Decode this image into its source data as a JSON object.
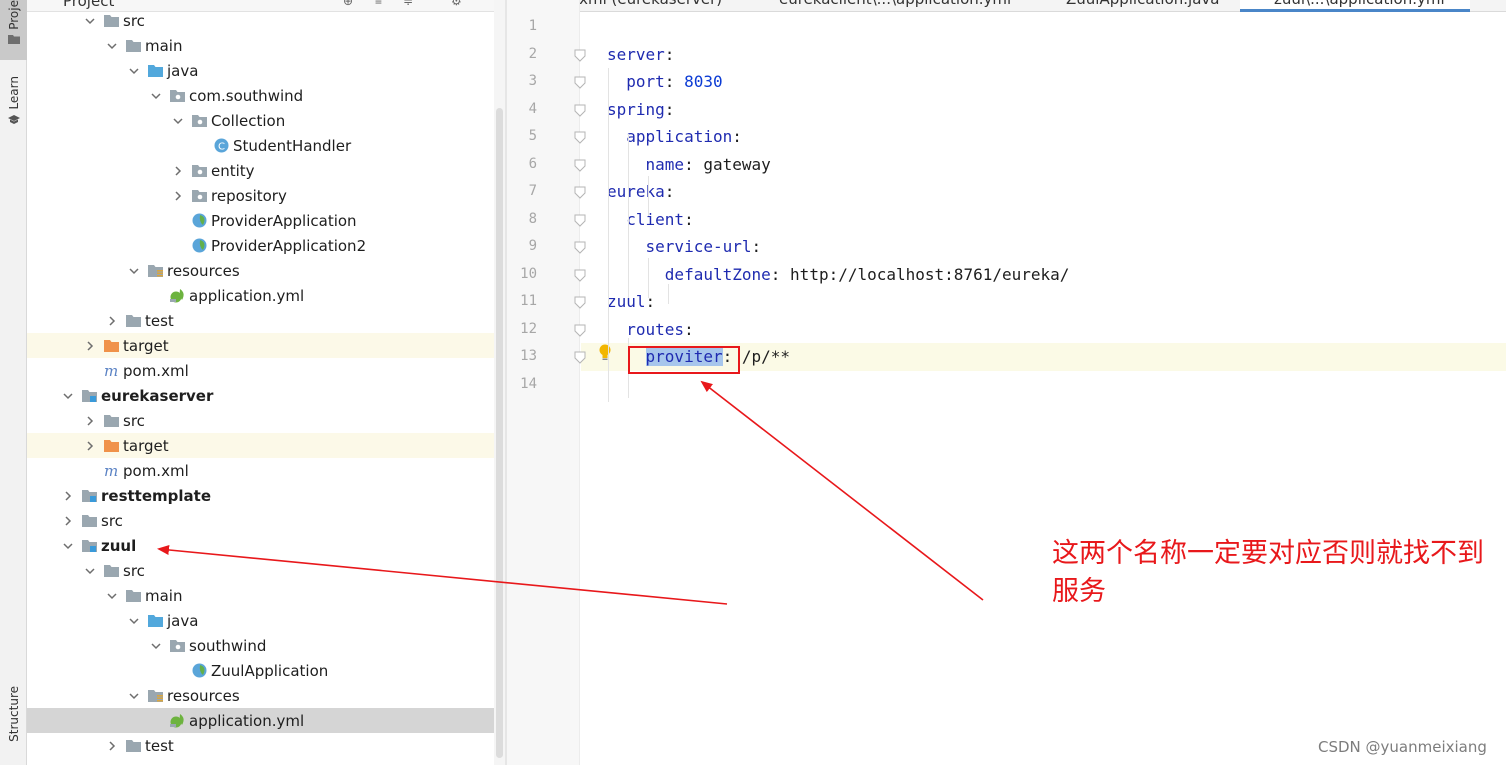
{
  "tool_strip": {
    "top_tab": "Proje",
    "learn_tab": "Learn",
    "structure_tab": "Structure"
  },
  "project_panel": {
    "title": "Project"
  },
  "tree": [
    {
      "label": "src",
      "icon": "folder-icon",
      "depth": 3,
      "expanded": true
    },
    {
      "label": "main",
      "icon": "folder-icon",
      "depth": 4,
      "expanded": true
    },
    {
      "label": "java",
      "icon": "source-folder-icon",
      "depth": 5,
      "expanded": true
    },
    {
      "label": "com.southwind",
      "icon": "package-icon",
      "depth": 6,
      "expanded": true
    },
    {
      "label": "Collection",
      "icon": "package-icon",
      "depth": 7,
      "expanded": true
    },
    {
      "label": "StudentHandler",
      "icon": "class-icon",
      "depth": 8,
      "expanded": null
    },
    {
      "label": "entity",
      "icon": "package-icon",
      "depth": 7,
      "expanded": false
    },
    {
      "label": "repository",
      "icon": "package-icon",
      "depth": 7,
      "expanded": false
    },
    {
      "label": "ProviderApplication",
      "icon": "spring-class-icon",
      "depth": 7,
      "expanded": null
    },
    {
      "label": "ProviderApplication2",
      "icon": "spring-class-icon",
      "depth": 7,
      "expanded": null
    },
    {
      "label": "resources",
      "icon": "resources-folder-icon",
      "depth": 5,
      "expanded": true
    },
    {
      "label": "application.yml",
      "icon": "spring-yml-icon",
      "depth": 6,
      "expanded": null
    },
    {
      "label": "test",
      "icon": "folder-icon",
      "depth": 4,
      "expanded": false
    },
    {
      "label": "target",
      "icon": "excluded-folder-icon",
      "depth": 3,
      "expanded": false,
      "highlight": true
    },
    {
      "label": "pom.xml",
      "icon": "maven-icon",
      "depth": 3,
      "expanded": null
    },
    {
      "label": "eurekaserver",
      "icon": "module-icon",
      "depth": 2,
      "expanded": true,
      "bold": true
    },
    {
      "label": "src",
      "icon": "folder-icon",
      "depth": 3,
      "expanded": false
    },
    {
      "label": "target",
      "icon": "excluded-folder-icon",
      "depth": 3,
      "expanded": false,
      "highlight": true
    },
    {
      "label": "pom.xml",
      "icon": "maven-icon",
      "depth": 3,
      "expanded": null
    },
    {
      "label": "resttemplate",
      "icon": "module-icon",
      "depth": 2,
      "expanded": false,
      "bold": true
    },
    {
      "label": "src",
      "icon": "folder-icon",
      "depth": 2,
      "expanded": false
    },
    {
      "label": "zuul",
      "icon": "module-icon",
      "depth": 2,
      "expanded": true,
      "bold": true
    },
    {
      "label": "src",
      "icon": "folder-icon",
      "depth": 3,
      "expanded": true
    },
    {
      "label": "main",
      "icon": "folder-icon",
      "depth": 4,
      "expanded": true
    },
    {
      "label": "java",
      "icon": "source-folder-icon",
      "depth": 5,
      "expanded": true
    },
    {
      "label": "southwind",
      "icon": "package-icon",
      "depth": 6,
      "expanded": true
    },
    {
      "label": "ZuulApplication",
      "icon": "spring-class-icon",
      "depth": 7,
      "expanded": null
    },
    {
      "label": "resources",
      "icon": "resources-folder-icon",
      "depth": 5,
      "expanded": true
    },
    {
      "label": "application.yml",
      "icon": "spring-yml-icon",
      "depth": 6,
      "expanded": null,
      "selected": true
    },
    {
      "label": "test",
      "icon": "folder-icon",
      "depth": 4,
      "expanded": false
    }
  ],
  "editor": {
    "tabs": [
      {
        "label": "pom.xml (eurekaserver)",
        "active": false
      },
      {
        "label": "eurekaclient\\...\\application.yml",
        "active": false
      },
      {
        "label": "ZuulApplication.java",
        "active": false
      },
      {
        "label": "zuul\\...\\application.yml",
        "active": true
      }
    ],
    "line_numbers": [
      "1",
      "2",
      "3",
      "4",
      "5",
      "6",
      "7",
      "8",
      "9",
      "10",
      "11",
      "12",
      "13",
      "14"
    ],
    "lines": [
      {
        "indent": "",
        "key": "",
        "value": ""
      },
      {
        "indent": "",
        "key": "server",
        "value": ""
      },
      {
        "indent": "  ",
        "key": "port",
        "value": "8030",
        "value_kind": "number"
      },
      {
        "indent": "",
        "key": "spring",
        "value": ""
      },
      {
        "indent": "  ",
        "key": "application",
        "value": ""
      },
      {
        "indent": "    ",
        "key": "name",
        "value": "gateway",
        "value_kind": "plain"
      },
      {
        "indent": "",
        "key": "eureka",
        "value": ""
      },
      {
        "indent": "  ",
        "key": "client",
        "value": ""
      },
      {
        "indent": "    ",
        "key": "service-url",
        "value": ""
      },
      {
        "indent": "      ",
        "key": "defaultZone",
        "value": "http://localhost:8761/eureka/",
        "value_kind": "plain"
      },
      {
        "indent": "",
        "key": "zuul",
        "value": ""
      },
      {
        "indent": "  ",
        "key": "routes",
        "value": ""
      },
      {
        "indent": "    ",
        "key": "proviter",
        "value": "/p/**",
        "value_kind": "plain",
        "selected_key": true
      },
      {
        "indent": "",
        "key": "",
        "value": ""
      }
    ]
  },
  "annotation": {
    "text": "这两个名称一定要对应否则就找不到服务",
    "color": "#e8181b"
  },
  "watermark": "CSDN @yuanmeixiang",
  "colors": {
    "yaml_key": "#1f2bb0",
    "yaml_number": "#0b3bd4",
    "selection": "#a7c6ec",
    "active_tab_underline": "#4a86c8"
  }
}
